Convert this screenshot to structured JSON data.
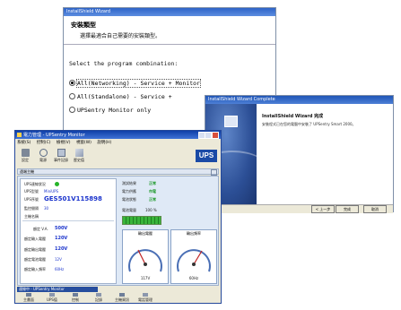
{
  "setup_dialog": {
    "title": "InstallShield Wizard",
    "heading": "安裝類型",
    "subheading": "選擇最適合自己需要的安裝類型。",
    "prompt": "Select the program combination:",
    "options": [
      {
        "label": "All(Networking) - Service + Monitor",
        "selected": true
      },
      {
        "label": "All(Standalone) - Service +",
        "selected": false
      },
      {
        "label": "UPSentry Monitor only",
        "selected": false
      }
    ]
  },
  "complete_dialog": {
    "title": "InstallShield Wizard Complete",
    "heading": "InstallShield Wizard 完成",
    "body": "安裝程式已在您的電腦中安裝了 UPSentry Smart 2000。",
    "back_label": "< 上一步",
    "finish_label": "完成",
    "cancel_label": "取消"
  },
  "monitor_window": {
    "title": "電力管理 - UPSentry Monitor",
    "menu": [
      "系統(S)",
      "控制(C)",
      "檢視(V)",
      "視窗(W)",
      "說明(H)"
    ],
    "toolbar": [
      "設定",
      "電源",
      "事件記錄",
      "歷史值"
    ],
    "ups_logo": "UPS",
    "tab": "遠端主機",
    "status_label": "UPS連線狀況",
    "status_color": "#27b42a",
    "model_label": "UPS型號",
    "model_value": "MiniUPS",
    "serial_label": "UPS序號",
    "serial_value": "GES501V115898",
    "interval_label": "監控間隔",
    "interval_value": "30",
    "host_label": "主機名稱",
    "specs": [
      {
        "label": "額定 V.A.",
        "value": "500V"
      },
      {
        "label": "額定輸入電壓",
        "value": "120V"
      },
      {
        "label": "額定輸出電壓",
        "value": "120V"
      },
      {
        "label": "額定電池電壓",
        "value": "12V"
      },
      {
        "label": "額定輸入頻率",
        "value": "60Hz"
      }
    ],
    "flags": [
      {
        "label": "測試結果",
        "value": "正常"
      },
      {
        "label": "電力供應",
        "value": "市電"
      },
      {
        "label": "電池狀態",
        "value": "正常"
      }
    ],
    "capacity_label": "電池電量",
    "capacity_value": "100 %",
    "capacity_fraction": 1.0,
    "gauge_left_title": "輸出電壓",
    "gauge_left_reading": "117V",
    "gauge_right_title": "輸出頻率",
    "gauge_right_reading": "60Hz",
    "bottom_tab": "連線中 - UPSentry Monitor",
    "bottom_toolbar": [
      "主畫面",
      "UPS值",
      "控制",
      "記錄",
      "主機資訊",
      "電話管理"
    ]
  }
}
